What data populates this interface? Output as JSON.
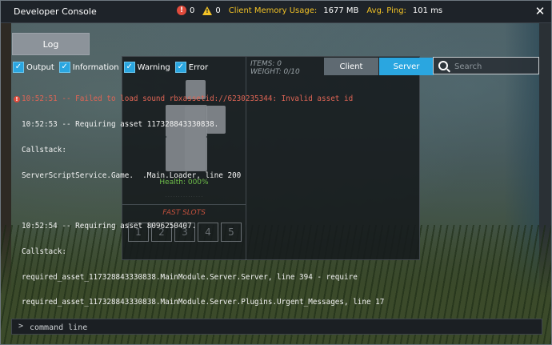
{
  "window": {
    "title": "Developer Console",
    "error_count": "0",
    "warning_count": "0",
    "memory_label": "Client Memory Usage:",
    "memory_value": "1677 MB",
    "ping_label": "Avg. Ping:",
    "ping_value": "101 ms",
    "close_glyph": "✕"
  },
  "toolbar": {
    "log_button": "Log"
  },
  "filters": [
    {
      "label": "Output",
      "checked": true
    },
    {
      "label": "Information",
      "checked": true
    },
    {
      "label": "Warning",
      "checked": true
    },
    {
      "label": "Error",
      "checked": true
    }
  ],
  "tabs": {
    "client": "Client",
    "server": "Server",
    "active": "Server"
  },
  "search": {
    "placeholder": "Search"
  },
  "log": {
    "error_line": "10:52:51 -- Failed to load sound rbxassetid://6230235344: Invalid asset id",
    "lines": [
      "10:52:53 -- Requiring asset 117328843330838.",
      "Callstack:",
      "ServerScriptService.Game.  .Main.Loader, line 200",
      "",
      "10:52:54 -- Requiring asset 8096250407.",
      "Callstack:",
      "required_asset_117328843330838.MainModule.Server.Server, line 394 - require",
      "required_asset_117328843330838.MainModule.Server.Plugins.Urgent_Messages, line 17"
    ]
  },
  "command": {
    "prompt": ">",
    "placeholder": "command line"
  },
  "background_inventory": {
    "items": "ITEMS: 0",
    "weight": "WEIGHT: 0/10",
    "health": "Health: 000%",
    "fast_slots_title": "FAST SLOTS",
    "slots": [
      "1",
      "2",
      "3",
      "4",
      "5"
    ]
  },
  "colors": {
    "accent": "#2aa6e0",
    "error": "#e04b3c",
    "warning": "#f2c226",
    "health": "#6fbf4a"
  }
}
